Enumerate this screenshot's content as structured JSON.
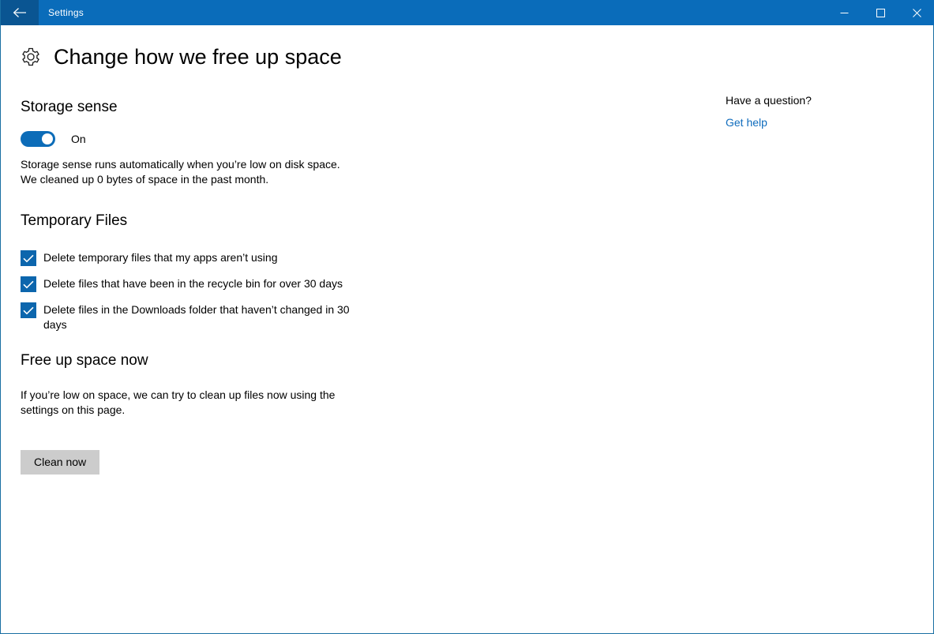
{
  "window": {
    "titlebar": {
      "back_label": "back-arrow",
      "app_title": "Settings",
      "minimize_label": "–",
      "maximize_label": "□",
      "close_label": "✕",
      "bar_color": "#0a6cba",
      "back_button_color": "#0a5592"
    }
  },
  "page": {
    "icon": "gear-icon",
    "title": "Change how we free up space"
  },
  "storage_sense": {
    "heading": "Storage sense",
    "toggle_state_label": "On",
    "toggle_on": true,
    "toggle_color": "#0c6cb8",
    "description_line1": "Storage sense runs automatically when you’re low on disk space.",
    "description_line2": "We cleaned up 0 bytes of space in the past month."
  },
  "temporary_files": {
    "heading": "Temporary Files",
    "checkbox_color": "#0c66ad",
    "items": [
      {
        "label": "Delete temporary files that my apps aren’t using",
        "checked": true
      },
      {
        "label": "Delete files that have been in the recycle bin for over 30 days",
        "checked": true
      },
      {
        "label": "Delete files in the Downloads folder that haven’t changed in 30 days",
        "checked": true
      }
    ]
  },
  "free_up_space": {
    "heading": "Free up space now",
    "description_line1": "If you’re low on space, we can try to clean up files now using the",
    "description_line2": "settings on this page.",
    "button_label": "Clean now",
    "button_color": "#cccccc"
  },
  "help": {
    "question": "Have a question?",
    "link_label": "Get help",
    "link_color": "#0f6cbd"
  }
}
